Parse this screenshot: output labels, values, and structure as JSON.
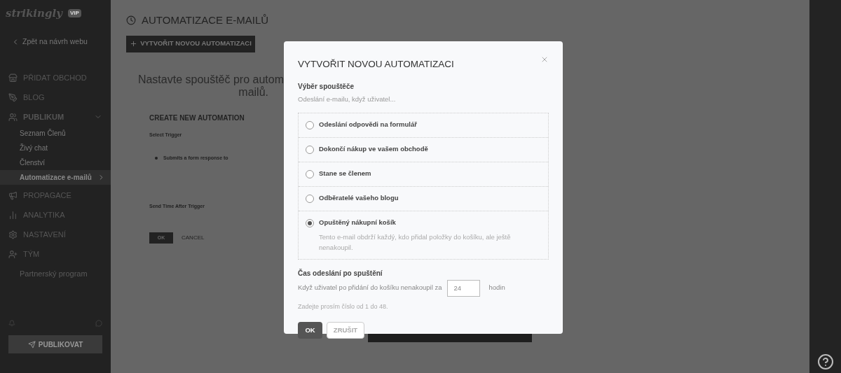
{
  "sidebar": {
    "logo": "strikingly",
    "logo_badge": "VIP",
    "back_link": "Zpět na návrh webu",
    "items": [
      {
        "label": "PŘIDAT OBCHOD",
        "kind": "section",
        "selected": false
      },
      {
        "label": "BLOG",
        "kind": "section",
        "selected": false
      },
      {
        "label": "PUBLIKUM",
        "kind": "section",
        "selected": false,
        "expanded": true,
        "children": [
          {
            "label": "Seznam Členů",
            "selected": false
          },
          {
            "label": "Živý chat",
            "selected": false
          },
          {
            "label": "Členství",
            "selected": false
          },
          {
            "label": "Automatizace e-mailů",
            "selected": true
          }
        ]
      },
      {
        "label": "PROPAGACE",
        "kind": "section",
        "selected": false
      },
      {
        "label": "ANALYTIKA",
        "kind": "section",
        "selected": false
      },
      {
        "label": "NASTAVENÍ",
        "kind": "section",
        "selected": false
      },
      {
        "label": "TÝM",
        "kind": "section",
        "selected": false
      },
      {
        "label": "Partnerský program",
        "kind": "link",
        "selected": false
      }
    ],
    "publish_button": "PUBLIKOVAT"
  },
  "page": {
    "title": "AUTOMATIZACE E-MAILŮ",
    "create_button": "VYTVOŘIT NOVOU AUTOMATIZACI",
    "heading_lines": [
      "Nastavte spouštěč pro autom",
      "mailů."
    ],
    "form": {
      "title": "CREATE NEW AUTOMATION",
      "trigger_label": "Select Trigger",
      "trigger_option": "Submits a form response to",
      "send_time_label": "Send Time After Trigger",
      "ok_button": "OK",
      "cancel_button": "CANCEL"
    }
  },
  "modal": {
    "title": "VYTVOŘIT NOVOU AUTOMATIZACI",
    "trigger_label": "Výběr spouštěče",
    "trigger_hint": "Odeslání e-mailu, když uživatel...",
    "options": [
      {
        "label": "Odeslání odpovědi na formulář",
        "selected": false
      },
      {
        "label": "Dokončí nákup ve vašem obchodě",
        "selected": false
      },
      {
        "label": "Stane se členem",
        "selected": false
      },
      {
        "label": "Odběratelé vašeho blogu",
        "selected": false
      },
      {
        "label": "Opuštěný nákupní košík",
        "selected": true,
        "description": "Tento e-mail obdrží každý, kdo přidal položky do košíku, ale ještě nenakoupil."
      }
    ],
    "time_label": "Čas odeslání po spuštění",
    "time_sentence": "Když uživatel po přidání do košíku nenakoupil za",
    "time_value": "24",
    "time_unit": "hodin",
    "time_help": "Zadejte prosím číslo od 1 do 48.",
    "buttons": [
      {
        "label": "OK",
        "kind": "primary"
      },
      {
        "label": "ZRUŠIT",
        "kind": "secondary"
      }
    ]
  }
}
